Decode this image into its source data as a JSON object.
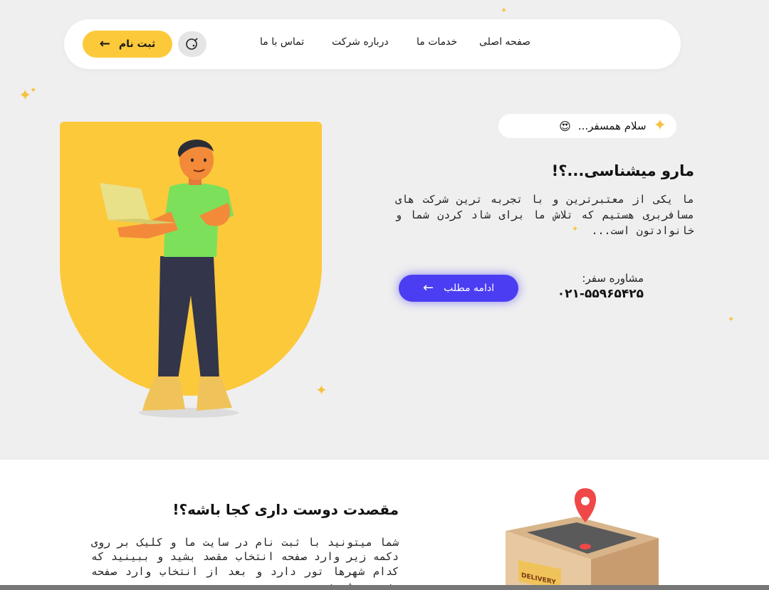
{
  "nav": {
    "links": [
      "صفحه اصلی",
      "خدمات ما",
      "درباره شرکت",
      "تماس با ما"
    ],
    "signup_label": "ثبت نام",
    "search_icon": "search-icon",
    "arrow_icon": "arrow-left-icon"
  },
  "hero": {
    "greeting": "سلام همسفر...",
    "greeting_emoji": "😍",
    "title": "مارو میشناسی...؟!",
    "description": "ما یکی از معتبرترین و با تجربه ترین شرکت های مسافربری هستیم که تلاش ما برای شاد کردن شما و خانوادتون است...",
    "consult_label": "مشاوره سفر:",
    "phone": "۰۲۱-۵۵۹۶۵۴۲۵",
    "more_label": "ادامه مطلب"
  },
  "section2": {
    "title": "مقصدت دوست داری کجا باشه؟!",
    "description": "شما میتونید با ثبت نام در سایت ما و کلیک بر روی دکمه زیر وارد صفحه انتخاب مقصد بشید و ببینید که کدام شهرها تور دارد و بعد از انتخاب وارد صفحه رزرو میشوید...",
    "illustration_label": "DELIVERY"
  },
  "colors": {
    "accent_yellow": "#fcc93b",
    "accent_blue": "#4b3df2",
    "background": "#efefef"
  }
}
